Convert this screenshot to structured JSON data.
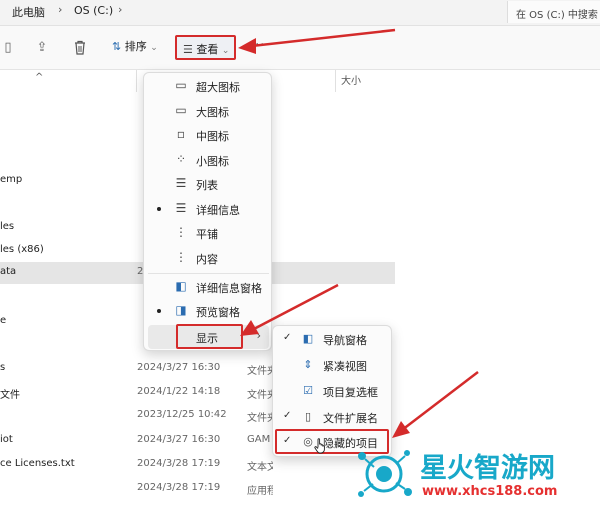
{
  "address": {
    "crumbs": [
      "此电脑",
      "OS (C:)"
    ],
    "search_placeholder": "在 OS (C:) 中搜索"
  },
  "toolbar": {
    "sort_label": "排序",
    "view_label": "查看",
    "more_label": "···"
  },
  "columns": {
    "size": "大小"
  },
  "rows": [
    {
      "name": "emp",
      "date": "",
      "type": "",
      "selected": false
    },
    {
      "name": "les",
      "date": "",
      "type": "",
      "selected": false
    },
    {
      "name": "les (x86)",
      "date": "",
      "type": "",
      "selected": false
    },
    {
      "name": "ata",
      "date": "2",
      "type": "",
      "selected": true
    },
    {
      "name": "e",
      "date": "",
      "type": "",
      "selected": false
    },
    {
      "name": "s",
      "date": "2024/3/27 16:30",
      "type": "文件夹",
      "selected": false
    },
    {
      "name": "文件",
      "date": "2024/1/22 14:18",
      "type": "文件夹",
      "selected": false
    },
    {
      "name": "",
      "date": "2023/12/25 10:42",
      "type": "文件夹",
      "selected": false
    },
    {
      "name": "iot",
      "date": "2024/3/27 16:30",
      "type": "GAM",
      "selected": false
    },
    {
      "name": "ce Licenses.txt",
      "date": "2024/3/28 17:19",
      "type": "文本文档",
      "selected": false
    },
    {
      "name": "",
      "date": "2024/3/28 17:19",
      "type": "应用程序",
      "selected": false
    }
  ],
  "view_menu": {
    "items": [
      {
        "label": "超大图标",
        "icon": "monitor-icon",
        "selected": false
      },
      {
        "label": "大图标",
        "icon": "monitor-icon",
        "selected": false
      },
      {
        "label": "中图标",
        "icon": "monitor-small-icon",
        "selected": false
      },
      {
        "label": "小图标",
        "icon": "small-icons-grid-icon",
        "selected": false
      },
      {
        "label": "列表",
        "icon": "list-icon",
        "selected": false
      },
      {
        "label": "详细信息",
        "icon": "details-icon",
        "selected": true
      },
      {
        "label": "平铺",
        "icon": "tiles-icon",
        "selected": false
      },
      {
        "label": "内容",
        "icon": "content-icon",
        "selected": false
      }
    ],
    "pane_items": [
      {
        "label": "详细信息窗格",
        "icon": "details-pane-icon",
        "selected": false
      },
      {
        "label": "预览窗格",
        "icon": "preview-pane-icon",
        "selected": true
      }
    ],
    "show_label": "显示"
  },
  "show_submenu": {
    "items": [
      {
        "label": "导航窗格",
        "checked": true,
        "icon": "navigation-pane-icon"
      },
      {
        "label": "紧凑视图",
        "checked": false,
        "icon": "compact-view-icon"
      },
      {
        "label": "项目复选框",
        "checked": false,
        "icon": "checkbox-icon"
      },
      {
        "label": "文件扩展名",
        "checked": true,
        "icon": "file-extension-icon"
      },
      {
        "label": "隐藏的项目",
        "checked": true,
        "icon": "hidden-items-icon"
      }
    ]
  },
  "watermark": {
    "main": "星火智游网",
    "url": "www.xhcs188.com"
  },
  "colors": {
    "highlight": "#d42b2b",
    "watermark_main": "#18a8c9",
    "watermark_url": "#e53030"
  }
}
